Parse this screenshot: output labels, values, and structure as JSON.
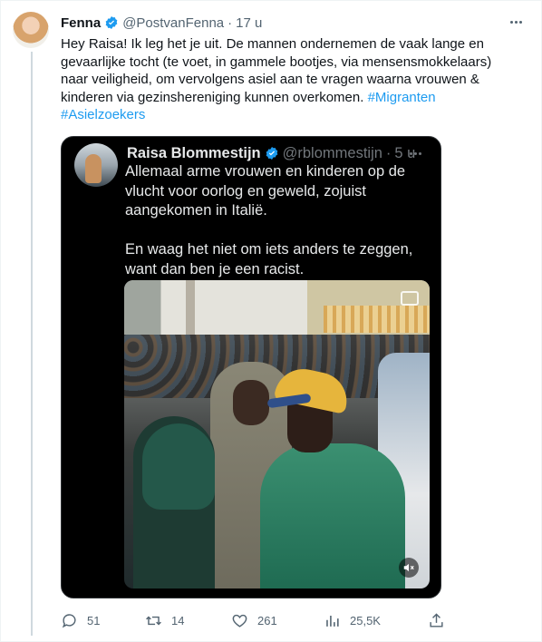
{
  "tweet": {
    "author_name": "Fenna",
    "handle": "@PostvanFenna",
    "separator": "·",
    "time": "17 u",
    "text_lines": [
      "Hey Raisa! Ik leg het je uit. De mannen ondernemen de vaak lange en",
      "gevaarlijke tocht (te voet, in gammele bootjes, via mensensmokkelaars)",
      "naar veiligheid, om vervolgens asiel aan te vragen waarna vrouwen &",
      "kinderen via gezinshereniging kunnen overkomen."
    ],
    "hashtag_inline": "#Migranten",
    "hashtag_second_line": "#Asielzoekers"
  },
  "quoted_tweet": {
    "author_name": "Raisa Blommestijn",
    "handle": "@rblommestijn",
    "separator": "·",
    "time": "5 u",
    "paragraph1": [
      "Allemaal arme vrouwen en kinderen op de",
      "vlucht voor oorlog en geweld, zojuist",
      "aangekomen in Italië."
    ],
    "paragraph2": [
      "En waag het niet om iets anders te zeggen,",
      "want dan ben je een racist."
    ]
  },
  "actions": {
    "replies": "51",
    "retweets": "14",
    "likes": "261",
    "views": "25,5K"
  },
  "icons": {
    "verified": "verified-badge-icon",
    "more": "more-icon",
    "reply": "reply-icon",
    "retweet": "retweet-icon",
    "like": "like-icon",
    "views": "views-icon",
    "share": "share-icon",
    "mute": "mute-icon",
    "gif": "gif-icon"
  },
  "colors": {
    "link": "#1d9bf0",
    "verified": "#1d9bf0",
    "secondary_text": "#536471"
  }
}
